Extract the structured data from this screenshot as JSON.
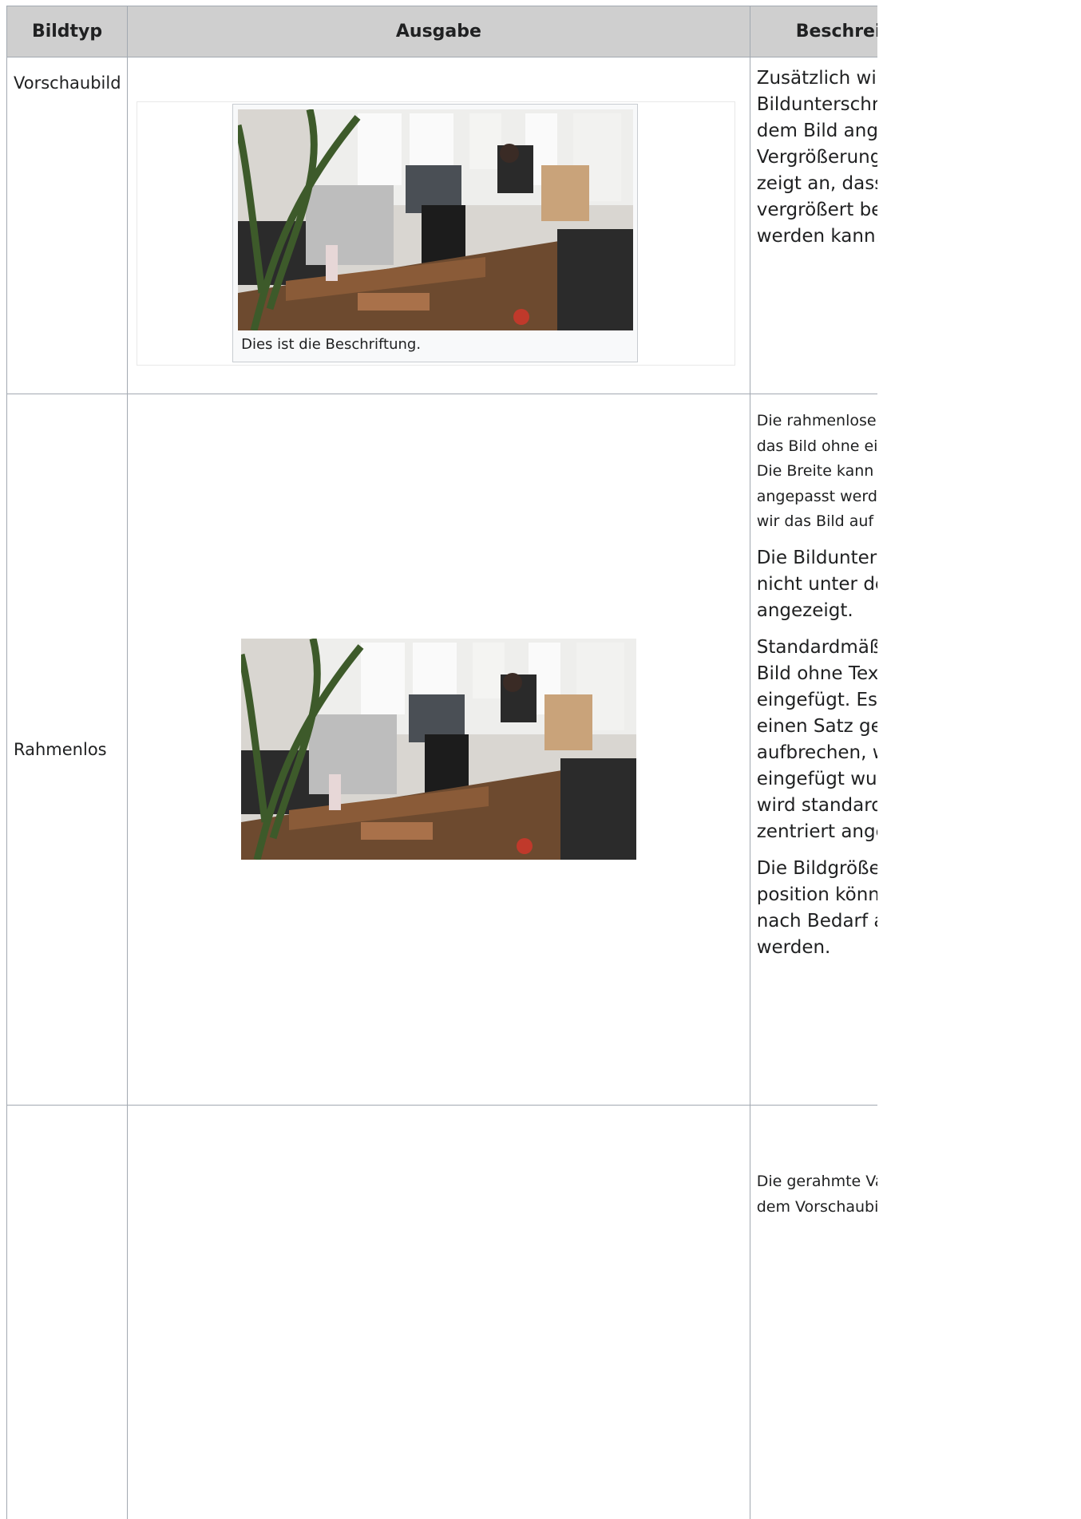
{
  "table": {
    "headers": [
      "Bildtyp",
      "Ausgabe",
      "Beschreibung"
    ],
    "rows": [
      {
        "type": "Vorschaubild",
        "caption": "Dies ist die Beschriftung.",
        "description": [
          "Zusätzlich wird eine Bildunterschrift unter dem Bild angezeigt. Ein Vergrößerungssymbol zeigt an, dass das Bild vergrößert betrachtet werden kann."
        ]
      },
      {
        "type": "Rahmenlos",
        "description": [
          "Die rahmenlose Option zeigt das Bild ohne einen Rahmen. Die Breite kann nach Bedarf angepasst werden (hier setzen wir das Bild auf 300px).",
          "Die Bildunterschrift wird nicht unter dem Bild angezeigt.",
          "Standardmäßig wird das Bild ohne Textumbruch eingefügt. Es würde einen Satz genau dort aufbrechen, wo er eingefügt wurde. Das Bild wird standardmäßig zentriert angezeigt.",
          "Die Bildgröße und -position können jedoch nach Bedarf angepasst werden."
        ]
      },
      {
        "type": "",
        "description": [
          "Die gerahmte Variante ähnelt dem Vorschaubild. Im"
        ]
      }
    ]
  },
  "image": {
    "alt": "office-photo",
    "subject": "Office workspace with desks, monitors and a plant"
  },
  "colors": {
    "header_bg": "#cfcfcf",
    "border": "#a2a9b1",
    "text": "#202122"
  }
}
